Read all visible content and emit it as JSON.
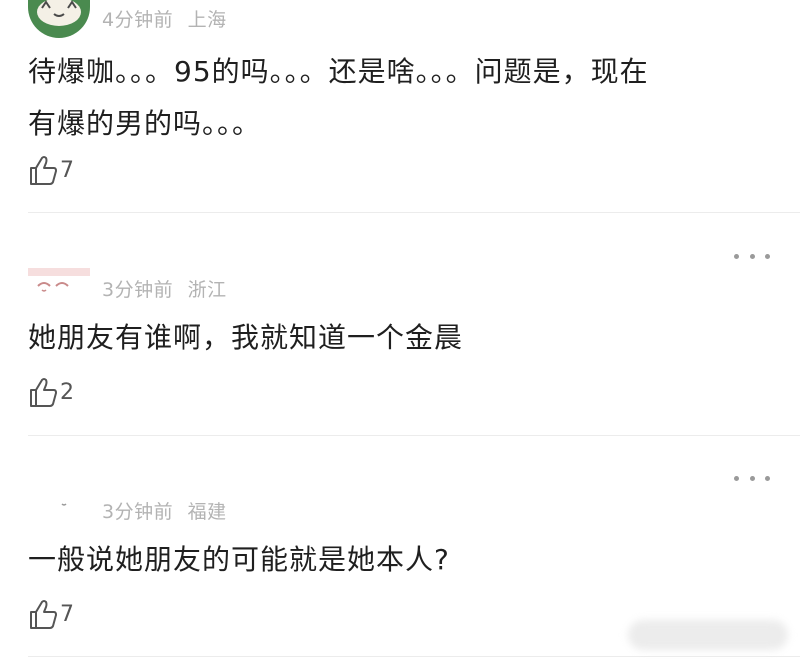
{
  "comments": [
    {
      "avatar_icon": "avatar-green-icon",
      "time": "4分钟前",
      "location": "上海",
      "text_line1": "待爆咖。。。95的吗。。。还是啥。。。问题是，现在",
      "text_line2": "有爆的男的吗。。。",
      "likes": "7"
    },
    {
      "avatar_icon": "avatar-pink-icon",
      "time": "3分钟前",
      "location": "浙江",
      "text_line1": "她朋友有谁啊，我就知道一个金晨",
      "likes": "2"
    },
    {
      "avatar_icon": "avatar-white-icon",
      "time": "3分钟前",
      "location": "福建",
      "text_line1": "一般说她朋友的可能就是她本人?",
      "likes": "7"
    }
  ],
  "colors": {
    "meta": "#b3b3b3",
    "text": "#1f1f1f",
    "icon": "#555555",
    "divider": "#ececec",
    "avatar_green": "#4a8a4f"
  }
}
